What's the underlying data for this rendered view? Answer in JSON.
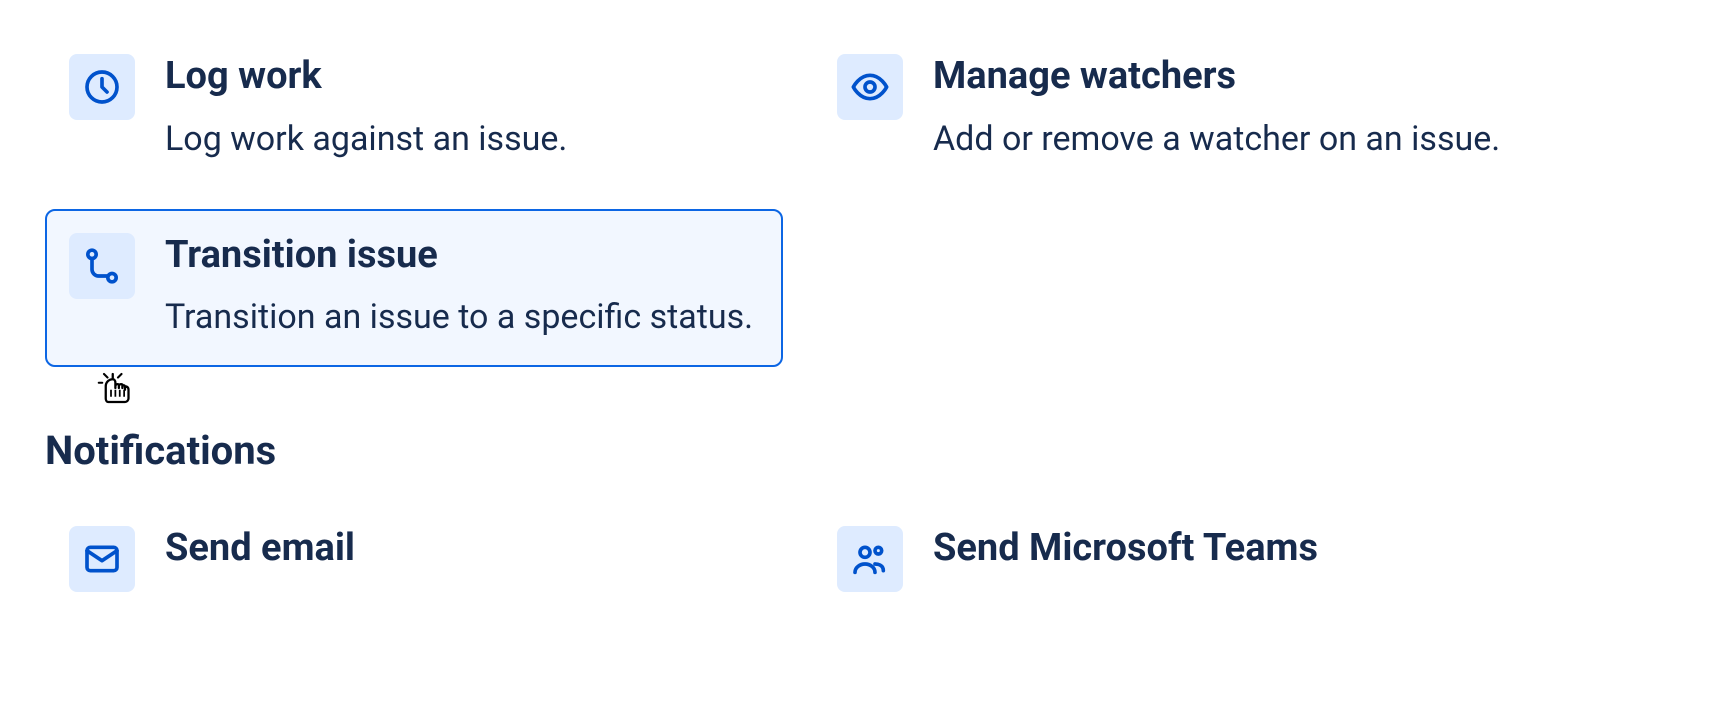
{
  "actions": {
    "logWork": {
      "title": "Log work",
      "desc": "Log work against an issue."
    },
    "manageWatchers": {
      "title": "Manage watchers",
      "desc": "Add or remove a watcher on an issue."
    },
    "transitionIssue": {
      "title": "Transition issue",
      "desc": "Transition an issue to a specific status."
    }
  },
  "sections": {
    "notifications": "Notifications"
  },
  "notificationActions": {
    "sendEmail": {
      "title": "Send email"
    },
    "sendTeams": {
      "title": "Send Microsoft Teams"
    }
  }
}
